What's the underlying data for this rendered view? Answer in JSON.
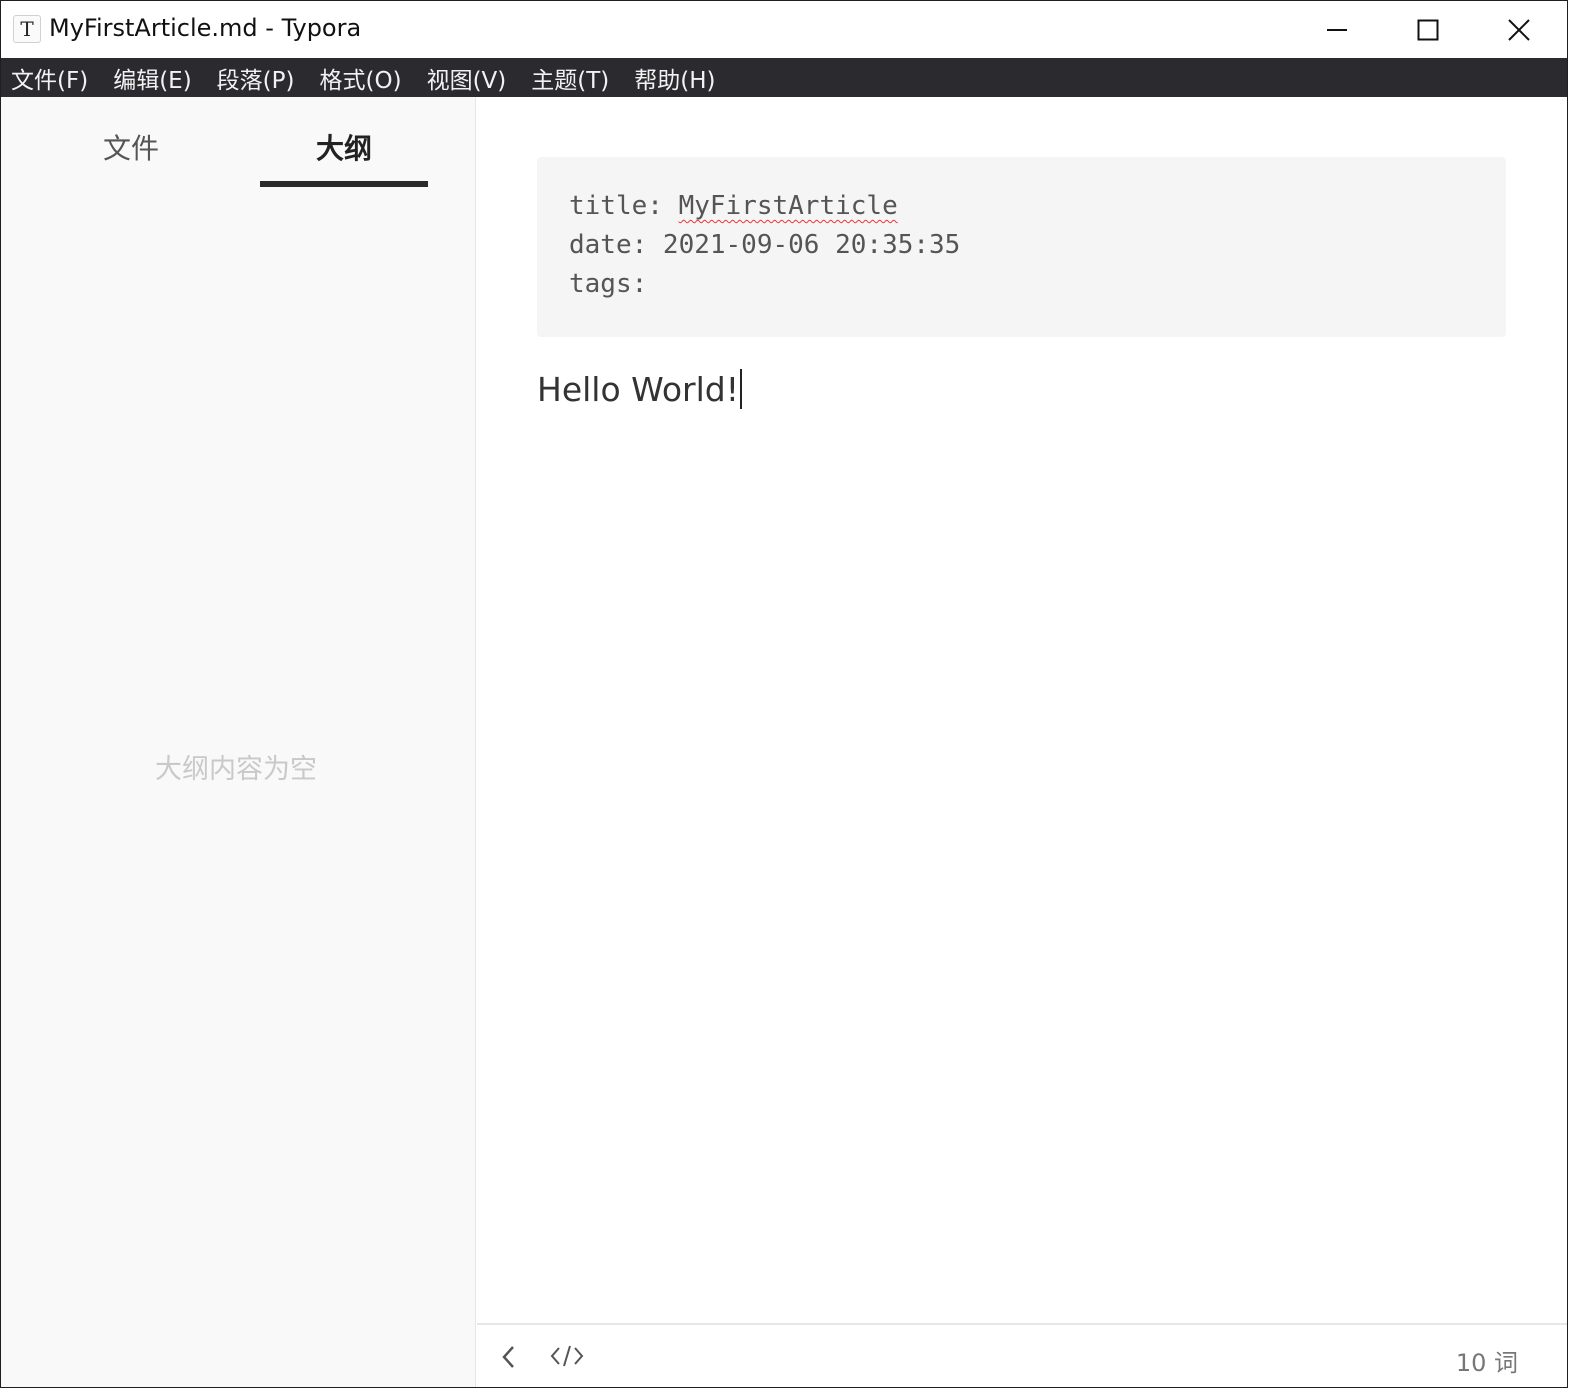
{
  "window": {
    "title": "MyFirstArticle.md - Typora",
    "app_icon_letter": "T"
  },
  "menubar": {
    "items": [
      "文件(F)",
      "编辑(E)",
      "段落(P)",
      "格式(O)",
      "视图(V)",
      "主题(T)",
      "帮助(H)"
    ]
  },
  "sidebar": {
    "tabs": [
      {
        "label": "文件",
        "active": false
      },
      {
        "label": "大纲",
        "active": true
      }
    ],
    "empty_message": "大纲内容为空"
  },
  "editor": {
    "front_matter": {
      "title_key": "title: ",
      "title_value": "MyFirstArticle",
      "date_line": "date: 2021-09-06 20:35:35",
      "tags_line": "tags:"
    },
    "body_text": "Hello World!"
  },
  "statusbar": {
    "word_count": "10 词"
  }
}
